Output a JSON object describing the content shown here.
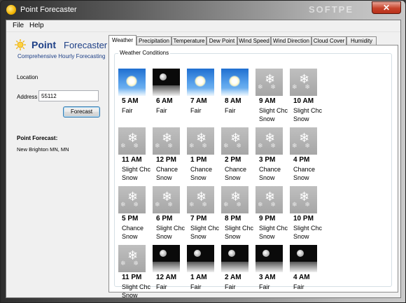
{
  "window": {
    "title": "Point Forecaster",
    "close_symbol": "✕",
    "watermark": "SOFTPE"
  },
  "menu": {
    "items": [
      "File",
      "Help"
    ]
  },
  "sidebar": {
    "logo_point": "Point",
    "logo_forecaster": "Forecaster",
    "logo_subtitle": "Comprehensive Hourly Forecasting",
    "location_label": "Location",
    "address_label": "Address",
    "address_value": "55112",
    "forecast_button": "Forecast",
    "point_forecast_label": "Point Forecast:",
    "point_forecast_place": "New Brighton MN, MN"
  },
  "tabs": [
    {
      "label": "Weather",
      "active": true
    },
    {
      "label": "Precipitation",
      "active": false
    },
    {
      "label": "Temperature",
      "active": false
    },
    {
      "label": "Dew Point",
      "active": false
    },
    {
      "label": "Wind Speed",
      "active": false
    },
    {
      "label": "Wind Direction",
      "active": false
    },
    {
      "label": "Cloud Cover",
      "active": false
    },
    {
      "label": "Humidity",
      "active": false
    }
  ],
  "weather": {
    "group_title": "Weather Conditions",
    "forecasts": [
      {
        "time": "5 AM",
        "condition": "Fair",
        "icon": "fair-day"
      },
      {
        "time": "6 AM",
        "condition": "Fair",
        "icon": "fair-night"
      },
      {
        "time": "7 AM",
        "condition": "Fair",
        "icon": "fair-day"
      },
      {
        "time": "8 AM",
        "condition": "Fair",
        "icon": "fair-day"
      },
      {
        "time": "9 AM",
        "condition": "Slight Chc Snow",
        "icon": "snow"
      },
      {
        "time": "10 AM",
        "condition": "Slight Chc Snow",
        "icon": "snow"
      },
      {
        "time": "11 AM",
        "condition": "Slight Chc Snow",
        "icon": "snow"
      },
      {
        "time": "12 PM",
        "condition": "Chance Snow",
        "icon": "snow"
      },
      {
        "time": "1 PM",
        "condition": "Chance Snow",
        "icon": "snow"
      },
      {
        "time": "2 PM",
        "condition": "Chance Snow",
        "icon": "snow"
      },
      {
        "time": "3 PM",
        "condition": "Chance Snow",
        "icon": "snow"
      },
      {
        "time": "4 PM",
        "condition": "Chance Snow",
        "icon": "snow"
      },
      {
        "time": "5 PM",
        "condition": "Chance Snow",
        "icon": "snow"
      },
      {
        "time": "6 PM",
        "condition": "Slight Chc Snow",
        "icon": "snow"
      },
      {
        "time": "7 PM",
        "condition": "Slight Chc Snow",
        "icon": "snow"
      },
      {
        "time": "8 PM",
        "condition": "Slight Chc Snow",
        "icon": "snow"
      },
      {
        "time": "9 PM",
        "condition": "Slight Chc Snow",
        "icon": "snow"
      },
      {
        "time": "10 PM",
        "condition": "Slight Chc Snow",
        "icon": "snow"
      },
      {
        "time": "11 PM",
        "condition": "Slight Chc Snow",
        "icon": "snow"
      },
      {
        "time": "12 AM",
        "condition": "Fair",
        "icon": "fair-night"
      },
      {
        "time": "1 AM",
        "condition": "Fair",
        "icon": "fair-night"
      },
      {
        "time": "2 AM",
        "condition": "Fair",
        "icon": "fair-night"
      },
      {
        "time": "3 AM",
        "condition": "Fair",
        "icon": "fair-night"
      },
      {
        "time": "4 AM",
        "condition": "Fair",
        "icon": "fair-night"
      }
    ]
  }
}
